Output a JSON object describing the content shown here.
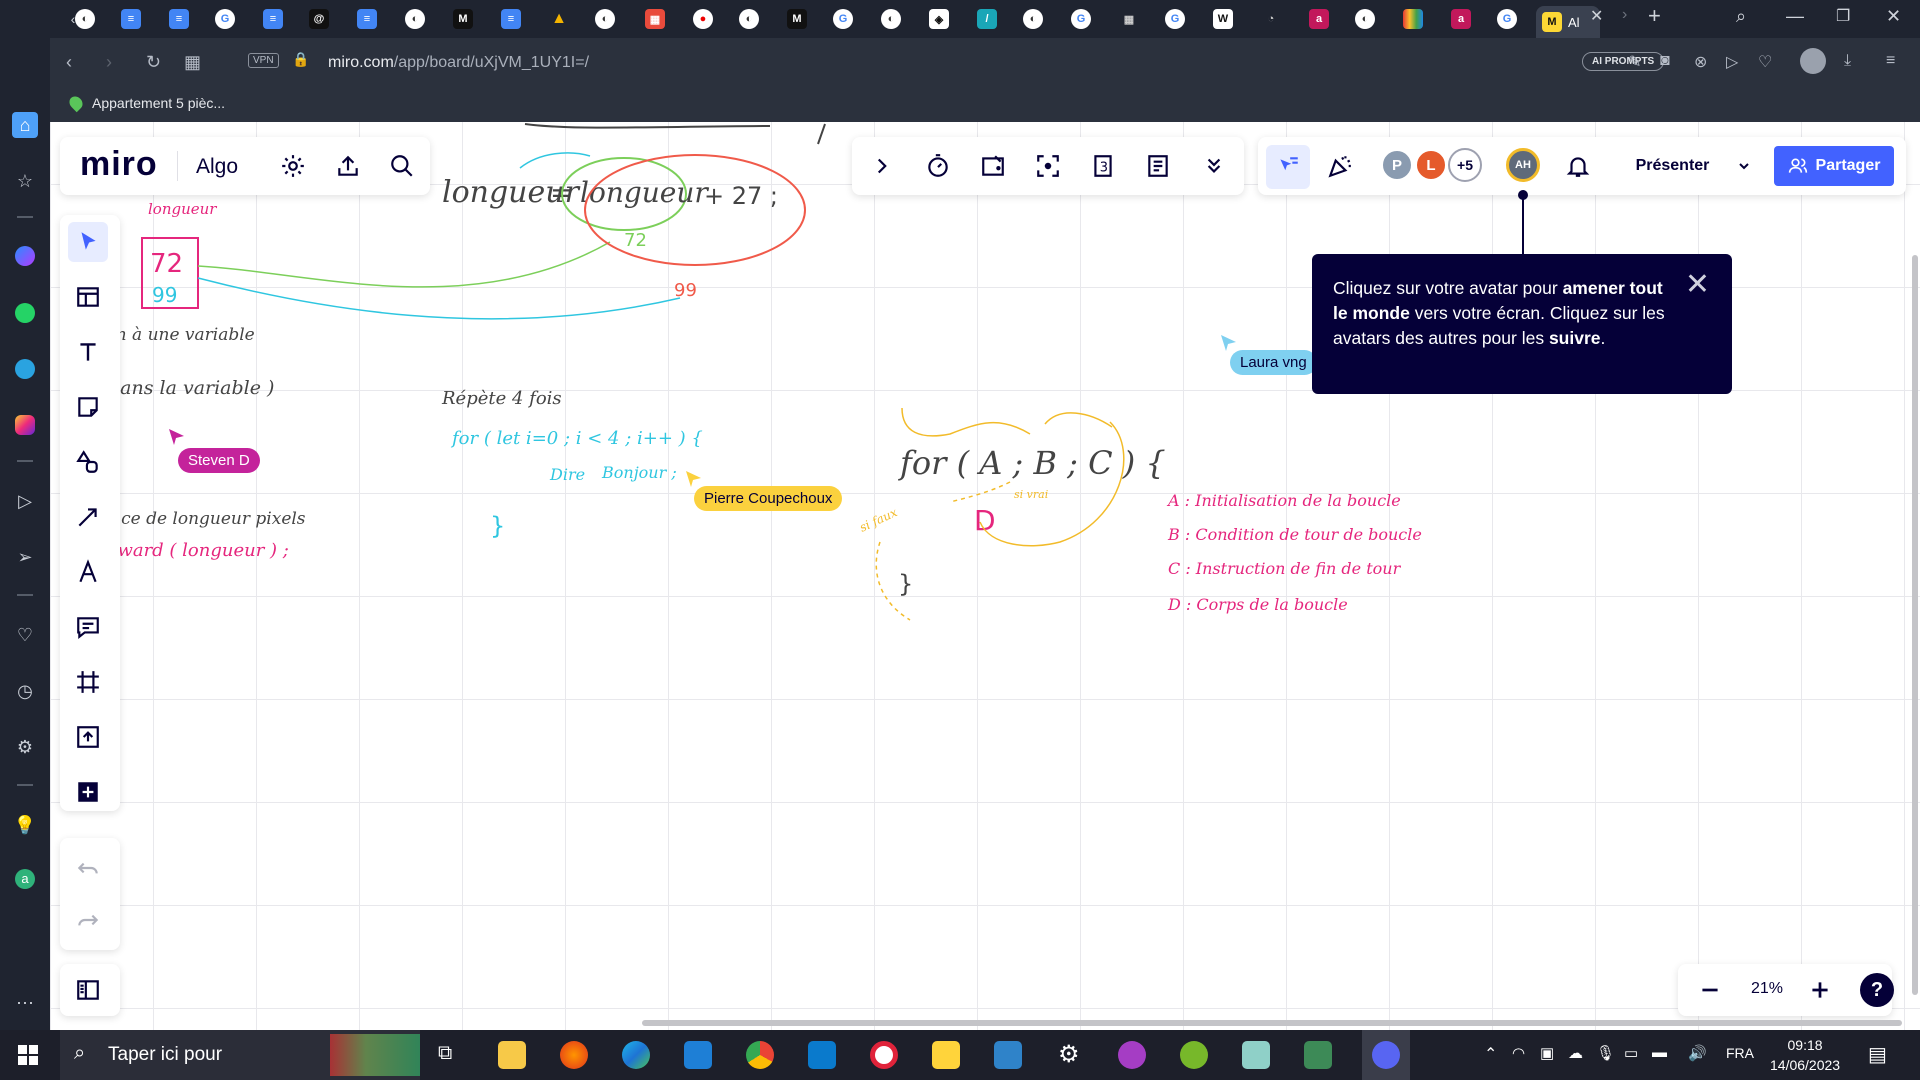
{
  "browser": {
    "active_tab_label": "Al",
    "url_host": "miro.com",
    "url_path": "/app/board/uXjVM_1UY1I=/",
    "vpn_label": "VPN",
    "ai_prompts_label": "AI PROMPTS",
    "bookmark_label": "Appartement 5 pièc..."
  },
  "miro": {
    "logo": "miro",
    "board_name": "Algo",
    "present_label": "Présenter",
    "share_label": "Partager",
    "avatars": [
      {
        "initial": "P",
        "color": "#8a9bb0"
      },
      {
        "initial": "L",
        "color": "#e55a2b"
      },
      {
        "initial": "+5",
        "color": "#ffffff"
      },
      {
        "initial": "AH",
        "color": "#5f6a7a"
      }
    ],
    "tooltip": {
      "t1": "Cliquez sur votre avatar pour ",
      "b1": "amener tout le monde",
      "t2": " vers votre écran. Cliquez sur les avatars des autres pour les ",
      "b2": "suivre",
      "t3": "."
    },
    "zoom": "21%",
    "help": "?"
  },
  "cursors": [
    {
      "name": "Steven D",
      "color": "#c4239b",
      "text_color": "#ffffff"
    },
    {
      "name": "Pierre Coupechoux",
      "color": "#fbd13e",
      "text_color": "#050038"
    },
    {
      "name": "Laura vng",
      "color": "#7fd0f0",
      "text_color": "#050038"
    }
  ],
  "handwriting": {
    "longueur_label": "longueur",
    "val_72": "72",
    "val_99": "99",
    "eq_left": "longueur",
    "eq_right": "longueur",
    "eq_plus": "+ 27 ;",
    "eq_eq": "=",
    "note1": "lon à une variable",
    "note2": "dans la variable )",
    "note3": "ance de longueur pixels",
    "note4": "orward ( longueur ) ;",
    "repete": "Répète 4 fois",
    "for_loop": "for ( let i=0 ; i < 4 ; i++ ) {",
    "dire": "Dire",
    "bonjour": "Bonjour ;",
    "close_brace": "}",
    "for_abc": "for ( A ; B ; C ) {",
    "d_letter": "D",
    "si_vrai": "si vrai",
    "si_faux": "si faux",
    "close_brace2": "}",
    "legend_a": "A : Initialisation de la boucle",
    "legend_b": "B : Condition de tour de boucle",
    "legend_c": "C : Instruction de fin de tour",
    "legend_d": "D : Corps de la boucle"
  },
  "taskbar": {
    "search_placeholder": "Taper ici pour",
    "lang": "FRA",
    "time": "09:18",
    "date": "14/06/2023"
  },
  "colors": {
    "miro_blue": "#4262ff",
    "ink_dark": "#050038",
    "pink": "#e5267d",
    "cyan": "#2fc6e0",
    "green": "#7ccf5a",
    "red": "#f05a4a",
    "orange_yellow": "#f2bb2a"
  }
}
